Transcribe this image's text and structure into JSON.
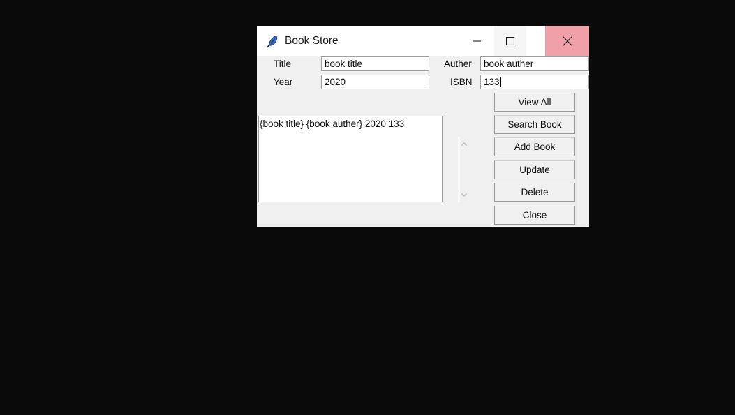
{
  "window": {
    "title": "Book Store",
    "icon": "feather-icon",
    "controls": {
      "minimize": "minimize-icon",
      "maximize": "maximize-icon",
      "close": "close-icon"
    },
    "close_button_color": "#efa0a8"
  },
  "form": {
    "fields": [
      {
        "label": "Title",
        "value": "book title",
        "placeholder": ""
      },
      {
        "label": "Year",
        "value": "2020",
        "placeholder": ""
      },
      {
        "label": "Auther",
        "value": "book auther",
        "placeholder": ""
      },
      {
        "label": "ISBN",
        "value": "133",
        "placeholder": "",
        "focused": true
      }
    ]
  },
  "list": {
    "rows": [
      "{book title} {book auther} 2020 133"
    ],
    "scrollbar": {
      "up_arrow": "chevron-up-icon",
      "down_arrow": "chevron-down-icon"
    }
  },
  "buttons": [
    {
      "label": "View All"
    },
    {
      "label": "Search Book"
    },
    {
      "label": "Add Book"
    },
    {
      "label": "Update"
    },
    {
      "label": "Delete"
    },
    {
      "label": "Close"
    }
  ],
  "colors": {
    "window_bg": "#f0f0f0",
    "titlebar_bg": "#ffffff",
    "entry_bg": "#ffffff",
    "border": "#a0a0a0",
    "text": "#101010"
  }
}
